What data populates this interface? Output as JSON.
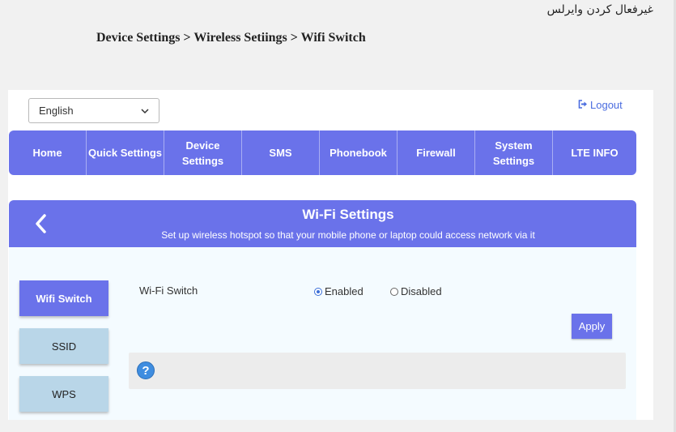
{
  "doc": {
    "title": "غیرفعال کردن وایرلس",
    "breadcrumb": "Device Settings > Wireless Setiings > Wifi Switch"
  },
  "header": {
    "language": "English",
    "logout_label": "Logout"
  },
  "nav": {
    "items": [
      "Home",
      "Quick Settings",
      "Device Settings",
      "SMS",
      "Phonebook",
      "Firewall",
      "System\nSettings",
      "LTE INFO"
    ]
  },
  "wifi_settings": {
    "title": "Wi-Fi Settings",
    "subtitle": "Set up wireless hotspot so that your mobile phone or laptop could access network via it"
  },
  "side_tabs": [
    "Wifi Switch",
    "SSID",
    "WPS"
  ],
  "form": {
    "label": "Wi-Fi Switch",
    "options": [
      "Enabled",
      "Disabled"
    ],
    "selected": "Enabled",
    "apply_label": "Apply",
    "help_glyph": "?"
  },
  "colors": {
    "accent": "#6a72ea",
    "side_tab": "#b9d6e8",
    "link": "#4a6cdf"
  },
  "icons": {
    "logout": "logout-icon",
    "back": "chevron-left-icon",
    "help": "question-icon",
    "dropdown": "chevron-down-icon"
  }
}
